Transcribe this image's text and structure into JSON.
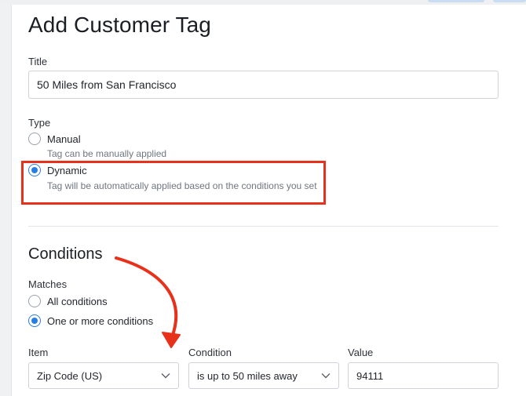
{
  "page": {
    "title": "Add Customer Tag"
  },
  "title_field": {
    "label": "Title",
    "value": "50 Miles from San Francisco"
  },
  "type_field": {
    "label": "Type",
    "options": [
      {
        "label": "Manual",
        "hint": "Tag can be manually applied",
        "checked": false
      },
      {
        "label": "Dynamic",
        "hint": "Tag will be automatically applied based on the conditions you set",
        "checked": true
      }
    ]
  },
  "conditions": {
    "title": "Conditions",
    "matches_label": "Matches",
    "match_options": [
      {
        "label": "All conditions",
        "checked": false
      },
      {
        "label": "One or more conditions",
        "checked": true
      }
    ],
    "columns": {
      "item": "Item",
      "condition": "Condition",
      "value": "Value"
    },
    "row": {
      "item": "Zip Code (US)",
      "condition": "is up to 50 miles away",
      "value": "94111"
    }
  },
  "annotation": {
    "highlight_color": "#e8311a",
    "arrow_color": "#e8311a"
  },
  "colors": {
    "accent": "#2a7de1"
  }
}
